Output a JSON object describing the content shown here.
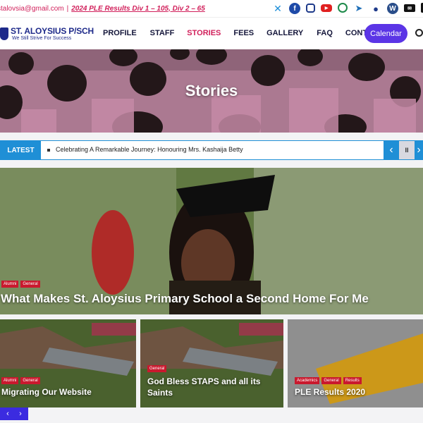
{
  "topbar": {
    "email": "stalovsia@gmail.com",
    "separator": "|",
    "results_link": "2024 PLE Results Div 1 – 105, Div 2 – 65",
    "social_icons": [
      "x-twitter-icon",
      "facebook-icon",
      "instagram-icon",
      "youtube-icon",
      "whatsapp-icon",
      "telegram-icon",
      "group-icon",
      "wordpress-icon",
      "email-icon",
      "phone-icon"
    ]
  },
  "nav": {
    "logo_title": "ST. ALOYSIUS P/SCH",
    "logo_tagline": "We Still Strive For Success",
    "items": [
      "PROFILE",
      "STAFF",
      "STORIES",
      "FEES",
      "GALLERY",
      "FAQ",
      "CONTACT"
    ],
    "active": "STORIES",
    "calendar_label": "Calendar"
  },
  "hero": {
    "title": "Stories"
  },
  "ticker": {
    "label": "LATEST",
    "text": "Celebrating A Remarkable Journey: Honouring Mrs. Kashaija Betty",
    "prev": "‹",
    "pause": "II",
    "next": "›"
  },
  "featured": {
    "tags": [
      "Alumni",
      "General"
    ],
    "title": "What Makes St. Aloysius Primary School a Second Home For Me"
  },
  "cards": [
    {
      "tags": [
        "Alumni",
        "General"
      ],
      "title": "Migrating Our Website"
    },
    {
      "tags": [
        "General"
      ],
      "title": "God Bless STAPS and all its Saints"
    },
    {
      "tags": [
        "Academics",
        "General",
        "Results"
      ],
      "title": "PLE Results 2020"
    }
  ],
  "pager": {
    "prev": "‹",
    "next": "›"
  },
  "colors": {
    "accent": "#d1205b",
    "brand": "#1e2a8a",
    "button": "#5b35e6",
    "ticker": "#1f8fd6",
    "tag": "#c9192e"
  }
}
